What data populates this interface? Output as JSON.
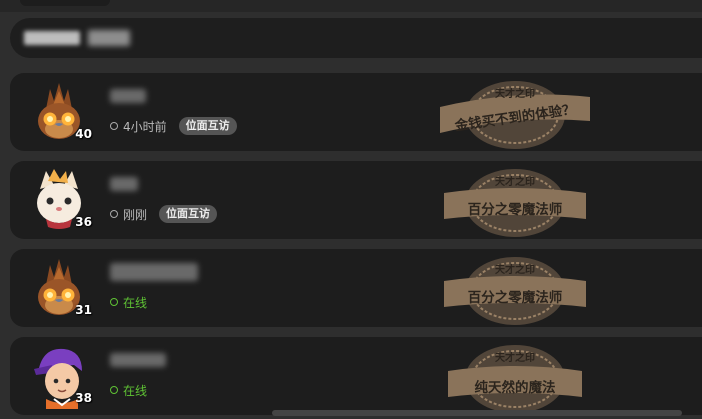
{
  "colors": {
    "background": "#2e2e2e",
    "row_background": "#1d1d1d",
    "online_green": "#5fc234",
    "stamp_tan": "#8a735a",
    "badge_grey": "#555555"
  },
  "search": {
    "value": ""
  },
  "friends": [
    {
      "avatar_icon": "bird-avatar-icon",
      "level": "40",
      "name": "",
      "status": "4小时前",
      "online": false,
      "visit_badge": "位面互访",
      "stamp_top": "天才之印",
      "stamp_title": "金钱买不到的体验？"
    },
    {
      "avatar_icon": "cat-avatar-icon",
      "level": "36",
      "name": "",
      "status": "刚刚",
      "online": false,
      "visit_badge": "位面互访",
      "stamp_top": "天才之印",
      "stamp_title": "百分之零魔法师"
    },
    {
      "avatar_icon": "bird-avatar-icon",
      "level": "31",
      "name": "",
      "status": "在线",
      "online": true,
      "visit_badge": "",
      "stamp_top": "天才之印",
      "stamp_title": "百分之零魔法师"
    },
    {
      "avatar_icon": "purple-hair-avatar-icon",
      "level": "38",
      "name": "",
      "status": "在线",
      "online": true,
      "visit_badge": "",
      "stamp_top": "天才之印",
      "stamp_title": "纯天然的魔法"
    }
  ]
}
